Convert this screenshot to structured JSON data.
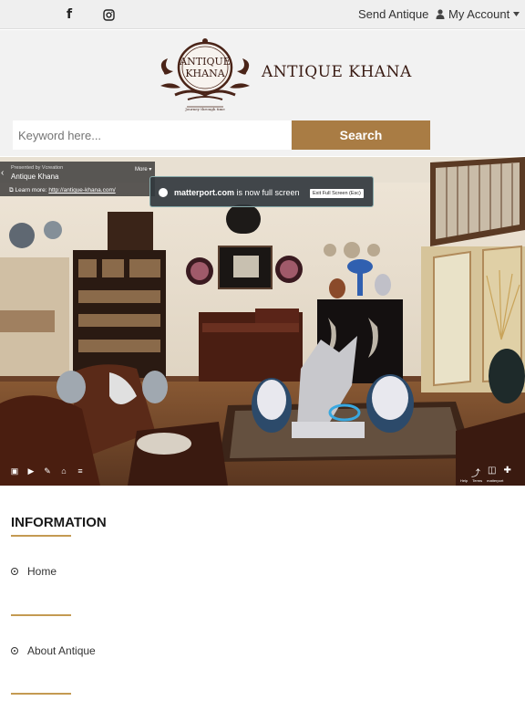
{
  "topbar": {
    "facebook_icon": "f",
    "instagram_icon": "instagram-icon",
    "send_antique": "Send Antique",
    "my_account": "My Account"
  },
  "logo": {
    "emblem_line1": "ANTIQUE",
    "emblem_line2": "KHANA",
    "tagline": "Journey through time",
    "brand_name": "ANTIQUE KHANA"
  },
  "search": {
    "placeholder": "Keyword here...",
    "button_label": "Search"
  },
  "viewer": {
    "presented_by": "Presented by Vcreation",
    "presented_name": "Antique Khana",
    "more_label": "More",
    "learn_more_label": "Learn more:",
    "learn_more_url": "http://antique-khana.com/",
    "fullscreen_brand": "matterport.com",
    "fullscreen_text": "is now full screen",
    "exit_fullscreen": "Exit Full Screen (Esc)",
    "credits": [
      "Help",
      "Terms",
      "matterport"
    ]
  },
  "information": {
    "title": "INFORMATION",
    "items": [
      "Home",
      "About Antique"
    ]
  },
  "colors": {
    "accent": "#a97c44",
    "brand_text": "#3a1c14",
    "rule": "#c49a52"
  }
}
